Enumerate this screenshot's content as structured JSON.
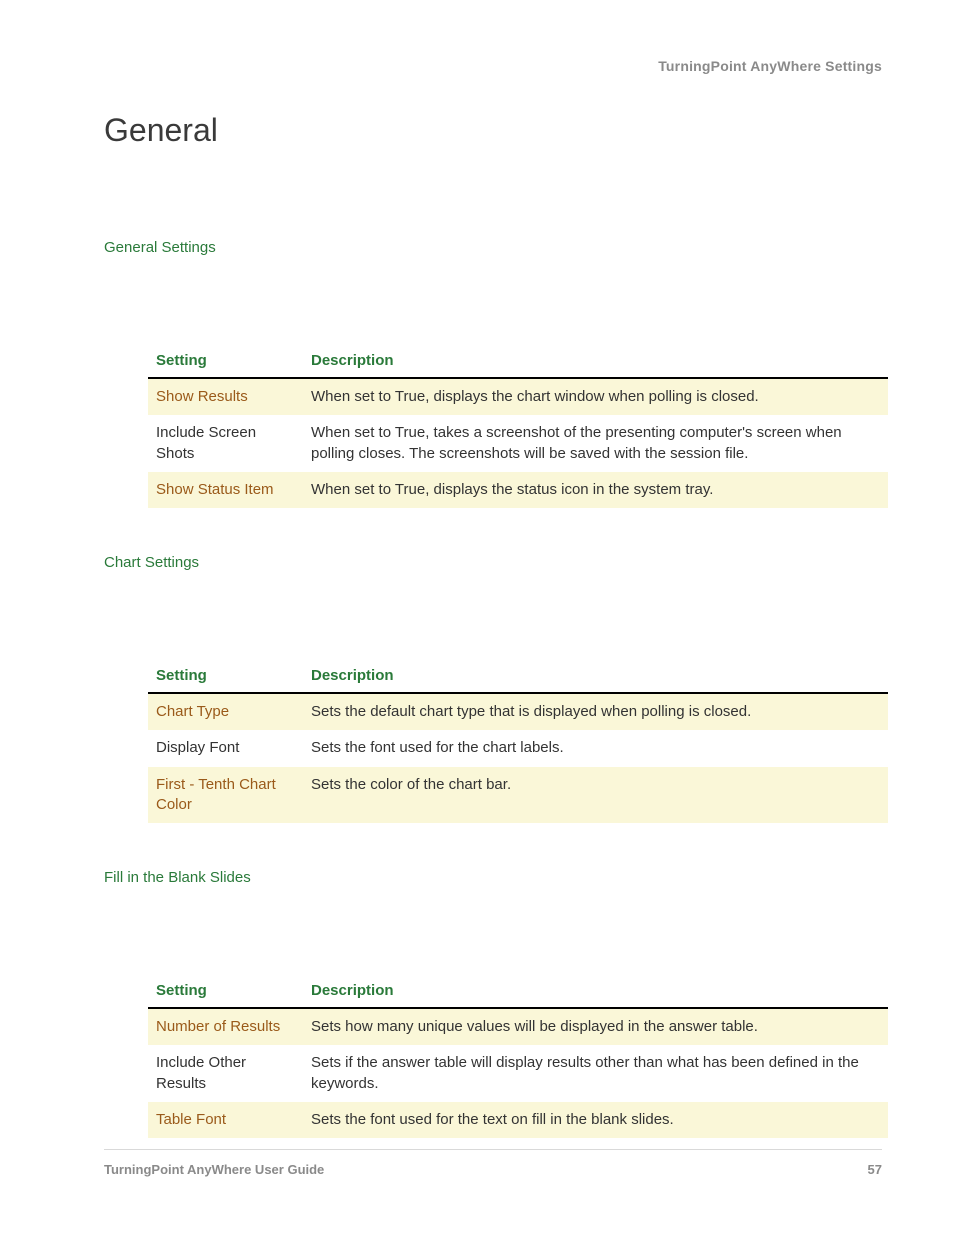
{
  "breadcrumb": "TurningPoint AnyWhere Settings",
  "page_title": "General",
  "footer": {
    "guide": "TurningPoint AnyWhere User Guide",
    "page_number": "57"
  },
  "headers": {
    "setting": "Setting",
    "description": "Description"
  },
  "sections": [
    {
      "heading": "General Settings",
      "rows": [
        {
          "stripe": true,
          "setting": "Show Results",
          "description": "When set to True, displays the chart window when polling is closed."
        },
        {
          "stripe": false,
          "setting": "Include Screen Shots",
          "description": "When set to True, takes a screenshot of the presenting computer's screen when polling closes. The screenshots will be saved with the session file."
        },
        {
          "stripe": true,
          "setting": "Show Status Item",
          "description": "When set to True, displays the status icon in the system tray."
        }
      ]
    },
    {
      "heading": "Chart Settings",
      "rows": [
        {
          "stripe": true,
          "setting": "Chart Type",
          "description": "Sets the default chart type that is displayed when polling is closed."
        },
        {
          "stripe": false,
          "setting": "Display Font",
          "description": "Sets the font used for the chart labels."
        },
        {
          "stripe": true,
          "setting": "First - Tenth Chart Color",
          "description": "Sets the color of the chart bar."
        }
      ]
    },
    {
      "heading": "Fill in the Blank Slides",
      "rows": [
        {
          "stripe": true,
          "setting": "Number of Results",
          "description": "Sets how many unique values will be displayed in the answer table."
        },
        {
          "stripe": false,
          "setting": "Include Other Results",
          "description": "Sets if the answer table will display results other than what has been defined in the keywords."
        },
        {
          "stripe": true,
          "setting": "Table Font",
          "description": "Sets the font used for the text on fill in the blank slides."
        }
      ]
    }
  ]
}
